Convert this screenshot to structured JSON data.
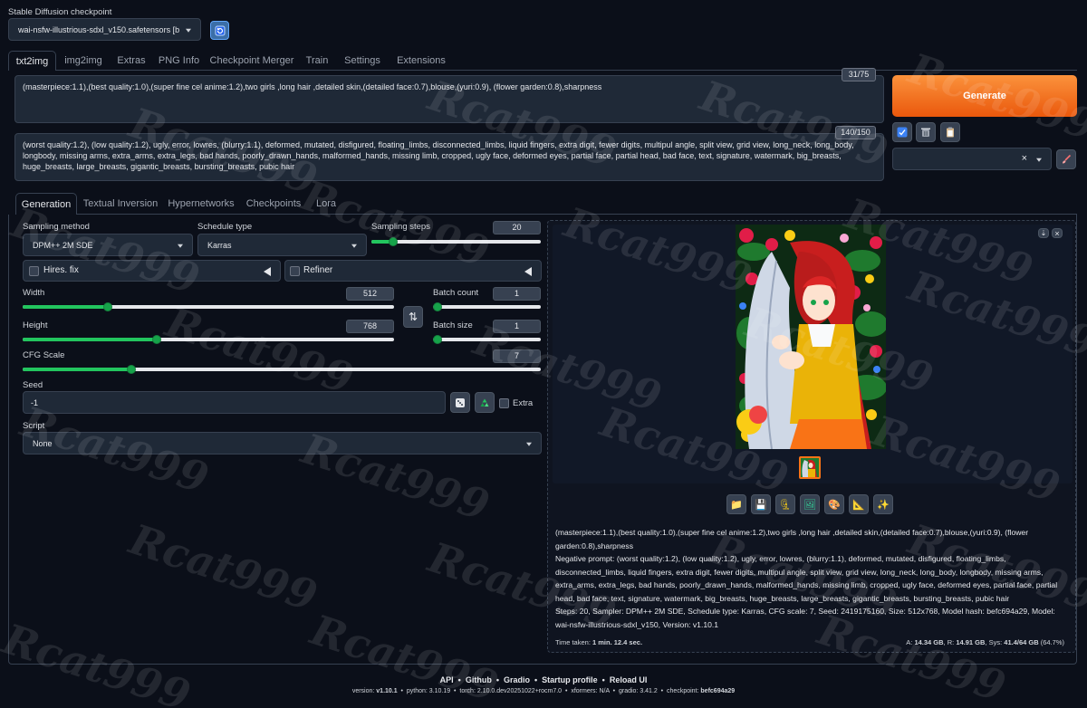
{
  "header": {
    "checkpoint_label": "Stable Diffusion checkpoint",
    "checkpoint_value": "wai-nsfw-illustrious-sdxl_v150.safetensors [befc",
    "refresh_icon": "refresh-icon"
  },
  "main_tabs": [
    "txt2img",
    "img2img",
    "Extras",
    "PNG Info",
    "Checkpoint Merger",
    "Train",
    "Settings",
    "Extensions"
  ],
  "positive_prompt": {
    "text": "(masterpiece:1.1),(best quality:1.0),(super fine cel anime:1.2),two girls ,long hair ,detailed skin,(detailed face:0.7),blouse,(yuri:0.9), (flower garden:0.8),sharpness",
    "token_count": "31/75"
  },
  "negative_prompt": {
    "text": "(worst quality:1.2), (low quality:1.2), ugly, error, lowres, (blurry:1.1), deformed, mutated, disfigured, floating_limbs, disconnected_limbs, liquid fingers, extra digit, fewer digits, multipul angle, split view, grid view, long_neck, long_body, longbody, missing arms, extra_arms, extra_legs, bad hands, poorly_drawn_hands, malformed_hands, missing limb, cropped, ugly face, deformed eyes, partial face, partial head, bad face, text, signature, watermark, big_breasts, huge_breasts, large_breasts, gigantic_breasts, bursting_breasts, pubic hair",
    "token_count": "140/150"
  },
  "generate_label": "Generate",
  "side_tools": {
    "icons": [
      "arrow-icon",
      "trash-icon",
      "clipboard-icon",
      "brush-icon"
    ],
    "styles_value": "",
    "styles_clear": "×"
  },
  "sub_tabs": [
    "Generation",
    "Textual Inversion",
    "Hypernetworks",
    "Checkpoints",
    "Lora"
  ],
  "generation": {
    "sampling_method_label": "Sampling method",
    "sampling_method_value": "DPM++ 2M SDE",
    "schedule_type_label": "Schedule type",
    "schedule_type_value": "Karras",
    "sampling_steps_label": "Sampling steps",
    "sampling_steps_value": "20",
    "sampling_steps_fraction": 0.13,
    "hires_label": "Hires. fix",
    "refiner_label": "Refiner",
    "width_label": "Width",
    "width_value": "512",
    "width_fraction": 0.23,
    "height_label": "Height",
    "height_value": "768",
    "height_fraction": 0.36,
    "batch_count_label": "Batch count",
    "batch_count_value": "1",
    "batch_size_label": "Batch size",
    "batch_size_value": "1",
    "cfg_label": "CFG Scale",
    "cfg_value": "7",
    "cfg_fraction": 0.21,
    "seed_label": "Seed",
    "seed_value": "-1",
    "extra_label": "Extra",
    "script_label": "Script",
    "script_value": "None",
    "swap_icon": "swap-arrows-icon",
    "dice_icon": "dice-icon",
    "recycle_icon": "recycle-icon"
  },
  "output": {
    "toolbar_icons": [
      "folder-icon",
      "save-icon",
      "zip-icon",
      "image-icon",
      "palette-icon",
      "ruler-icon",
      "sparkle-icon"
    ],
    "info_prompt": "(masterpiece:1.1),(best quality:1.0),(super fine cel anime:1.2),two girls ,long hair ,detailed skin,(detailed face:0.7),blouse,(yuri:0.9), (flower garden:0.8),sharpness",
    "info_negative_label": "Negative prompt:",
    "info_negative": "(worst quality:1.2), (low quality:1.2), ugly, error, lowres, (blurry:1.1), deformed, mutated, disfigured, floating_limbs, disconnected_limbs, liquid fingers, extra digit, fewer digits, multipul angle, split view, grid view, long_neck, long_body, longbody, missing arms, extra_arms, extra_legs, bad hands, poorly_drawn_hands, malformed_hands, missing limb, cropped, ugly face, deformed eyes, partial face, partial head, bad face, text, signature, watermark, big_breasts, huge_breasts, large_breasts, gigantic_breasts, bursting_breasts, pubic hair",
    "info_params": "Steps: 20, Sampler: DPM++ 2M SDE, Schedule type: Karras, CFG scale: 7, Seed: 2419175160, Size: 512x768, Model hash: befc694a29, Model: wai-nsfw-illustrious-sdxl_v150, Version: v1.10.1",
    "time_taken_label": "Time taken:",
    "time_taken_value": "1 min. 12.4 sec.",
    "vram_a_label": "A:",
    "vram_a_value": "14.34 GB",
    "vram_r_label": ", R:",
    "vram_r_value": "14.91 GB",
    "vram_sys_label": ", Sys:",
    "vram_sys_value": "41.4/64 GB",
    "vram_pct": "(64.7%)"
  },
  "footer": {
    "links": [
      "API",
      "Github",
      "Gradio",
      "Startup profile",
      "Reload UI"
    ],
    "version_label": "version:",
    "version_value": "v1.10.1",
    "python_label": "python:",
    "python_value": "3.10.19",
    "torch_label": "torch:",
    "torch_value": "2.10.0.dev20251022+rocm7.0",
    "xformers_label": "xformers:",
    "xformers_value": "N/A",
    "gradio_label": "gradio:",
    "gradio_value": "3.41.2",
    "checkpoint_label": "checkpoint:",
    "checkpoint_value": "befc694a29"
  },
  "watermark_text": "Rcat999",
  "colors": {
    "background": "#0b0f19",
    "panel": "#1f2937",
    "accent_orange": "#f97316",
    "slider_green": "#22c55e"
  }
}
